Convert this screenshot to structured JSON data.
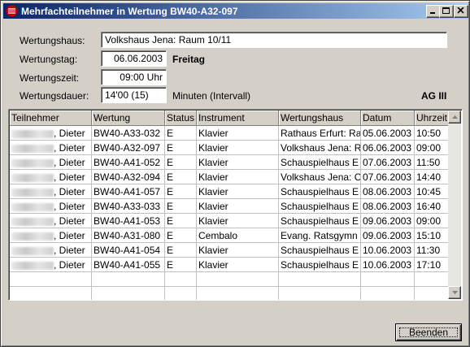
{
  "window": {
    "title": "Mehrfachteilnehmer in Wertung BW40-A32-097",
    "minimize": "_",
    "maximize": "□",
    "close": "×"
  },
  "form": {
    "wertungshaus_label": "Wertungshaus:",
    "wertungshaus_value": "Volkshaus Jena: Raum 10/11",
    "wertungstag_label": "Wertungstag:",
    "wertungstag_value": "06.06.2003",
    "weekday": "Freitag",
    "wertungszeit_label": "Wertungszeit:",
    "wertungszeit_value": "09:00 Uhr",
    "wertungsdauer_label": "Wertungsdauer:",
    "wertungsdauer_value": "14'00   (15)",
    "dauer_unit": "Minuten (Intervall)",
    "ag_label": "AG III"
  },
  "table": {
    "columns": [
      "Teilnehmer",
      "Wertung",
      "Status",
      "Instrument",
      "Wertungshaus",
      "Datum",
      "Uhrzeit"
    ],
    "rows": [
      {
        "name": ", Dieter",
        "wertung": "BW40-A33-032",
        "status": "E",
        "instrument": "Klavier",
        "haus": "Rathaus Erfurt: Ra",
        "datum": "05.06.2003",
        "zeit": "10:50"
      },
      {
        "name": ", Dieter",
        "wertung": "BW40-A32-097",
        "status": "E",
        "instrument": "Klavier",
        "haus": "Volkshaus Jena: R",
        "datum": "06.06.2003",
        "zeit": "09:00"
      },
      {
        "name": ", Dieter",
        "wertung": "BW40-A41-052",
        "status": "E",
        "instrument": "Klavier",
        "haus": "Schauspielhaus E",
        "datum": "07.06.2003",
        "zeit": "11:50"
      },
      {
        "name": ", Dieter",
        "wertung": "BW40-A32-094",
        "status": "E",
        "instrument": "Klavier",
        "haus": "Volkshaus Jena: C",
        "datum": "07.06.2003",
        "zeit": "14:40"
      },
      {
        "name": ", Dieter",
        "wertung": "BW40-A41-057",
        "status": "E",
        "instrument": "Klavier",
        "haus": "Schauspielhaus E",
        "datum": "08.06.2003",
        "zeit": "10:45"
      },
      {
        "name": ", Dieter",
        "wertung": "BW40-A33-033",
        "status": "E",
        "instrument": "Klavier",
        "haus": "Schauspielhaus E",
        "datum": "08.06.2003",
        "zeit": "16:40"
      },
      {
        "name": ", Dieter",
        "wertung": "BW40-A41-053",
        "status": "E",
        "instrument": "Klavier",
        "haus": "Schauspielhaus E",
        "datum": "09.06.2003",
        "zeit": "09:00"
      },
      {
        "name": ", Dieter",
        "wertung": "BW40-A31-080",
        "status": "E",
        "instrument": "Cembalo",
        "haus": "Evang. Ratsgymn",
        "datum": "09.06.2003",
        "zeit": "15:10"
      },
      {
        "name": ", Dieter",
        "wertung": "BW40-A41-054",
        "status": "E",
        "instrument": "Klavier",
        "haus": "Schauspielhaus E",
        "datum": "10.06.2003",
        "zeit": "11:30"
      },
      {
        "name": ", Dieter",
        "wertung": "BW40-A41-055",
        "status": "E",
        "instrument": "Klavier",
        "haus": "Schauspielhaus E",
        "datum": "10.06.2003",
        "zeit": "17:10"
      }
    ]
  },
  "buttons": {
    "beenden": "Beenden"
  }
}
